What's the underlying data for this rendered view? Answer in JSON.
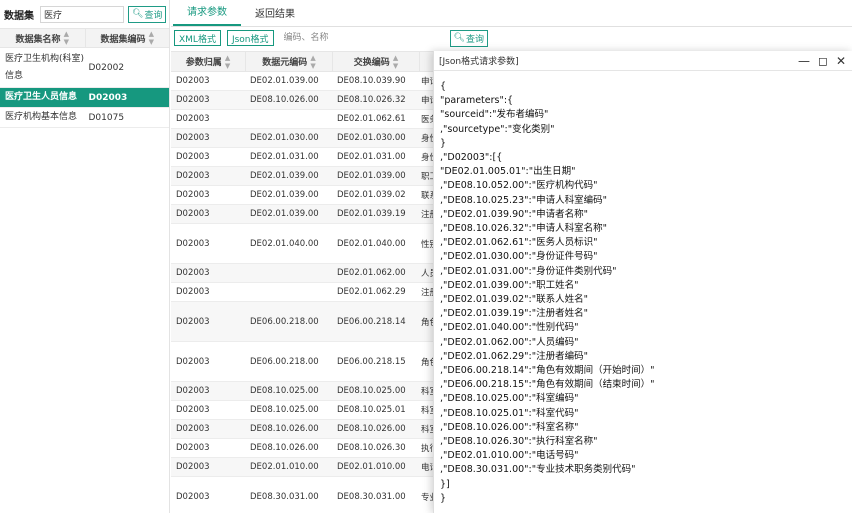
{
  "left_panel": {
    "title": "数据集",
    "search_value": "医疗",
    "query_label": "查询",
    "columns": [
      "数据集名称",
      "数据集编码"
    ],
    "rows": [
      {
        "name_line1": "医疗卫生机构(科室)",
        "name_line2": "信息",
        "code": "D02002",
        "selected": false
      },
      {
        "name_line1": "医疗卫生人员信息",
        "name_line2": "",
        "code": "D02003",
        "selected": true
      },
      {
        "name_line1": "医疗机构基本信息",
        "name_line2": "",
        "code": "D01075",
        "selected": false
      }
    ]
  },
  "tabs": [
    {
      "label": "请求参数",
      "active": true
    },
    {
      "label": "返回结果",
      "active": false
    }
  ],
  "toolbar": {
    "xml_label": "XML格式",
    "json_label": "Json格式",
    "search_placeholder": "编码、名称",
    "query_label": "查询"
  },
  "grid": {
    "columns": [
      "参数归属",
      "数据元编码",
      "交换编码"
    ],
    "rows": [
      {
        "owner": "D02003",
        "element": "DE02.01.039.00",
        "exchange": "DE08.10.039.90",
        "name": "申请",
        "h": 19
      },
      {
        "owner": "D02003",
        "element": "DE08.10.026.00",
        "exchange": "DE08.10.026.32",
        "name": "申请",
        "h": 19
      },
      {
        "owner": "D02003",
        "element": "",
        "exchange": "DE02.01.062.61",
        "name": "医务",
        "h": 19
      },
      {
        "owner": "D02003",
        "element": "DE02.01.030.00",
        "exchange": "DE02.01.030.00",
        "name": "身份",
        "h": 19
      },
      {
        "owner": "D02003",
        "element": "DE02.01.031.00",
        "exchange": "DE02.01.031.00",
        "name": "身份",
        "h": 19
      },
      {
        "owner": "D02003",
        "element": "DE02.01.039.00",
        "exchange": "DE02.01.039.00",
        "name": "职工",
        "h": 19
      },
      {
        "owner": "D02003",
        "element": "DE02.01.039.00",
        "exchange": "DE02.01.039.02",
        "name": "联系",
        "h": 19
      },
      {
        "owner": "D02003",
        "element": "DE02.01.039.00",
        "exchange": "DE02.01.039.19",
        "name": "注册",
        "h": 19
      },
      {
        "owner": "D02003",
        "element": "DE02.01.040.00",
        "exchange": "DE02.01.040.00",
        "name": "性别",
        "h": 40
      },
      {
        "owner": "D02003",
        "element": "",
        "exchange": "DE02.01.062.00",
        "name": "人员",
        "h": 19
      },
      {
        "owner": "D02003",
        "element": "",
        "exchange": "DE02.01.062.29",
        "name": "注册",
        "h": 19
      },
      {
        "owner": "D02003",
        "element": "DE06.00.218.00",
        "exchange": "DE06.00.218.14",
        "name": "角色",
        "h": 40
      },
      {
        "owner": "D02003",
        "element": "DE06.00.218.00",
        "exchange": "DE06.00.218.15",
        "name": "角色",
        "h": 40
      },
      {
        "owner": "D02003",
        "element": "DE08.10.025.00",
        "exchange": "DE08.10.025.00",
        "name": "科室",
        "h": 19
      },
      {
        "owner": "D02003",
        "element": "DE08.10.025.00",
        "exchange": "DE08.10.025.01",
        "name": "科室",
        "h": 19
      },
      {
        "owner": "D02003",
        "element": "DE08.10.026.00",
        "exchange": "DE08.10.026.00",
        "name": "科室",
        "h": 19
      },
      {
        "owner": "D02003",
        "element": "DE08.10.026.00",
        "exchange": "DE08.10.026.30",
        "name": "执行",
        "h": 19
      },
      {
        "owner": "D02003",
        "element": "DE02.01.010.00",
        "exchange": "DE02.01.010.00",
        "name": "电话",
        "h": 19
      },
      {
        "owner": "D02003",
        "element": "DE08.30.031.00",
        "exchange": "DE08.30.031.00",
        "name": "专业",
        "h": 40
      }
    ]
  },
  "dialog": {
    "title": "[Json格式请求参数]",
    "content": "{\n\"parameters\":{\n\"sourceid\":\"发布者编码\"\n,\"sourcetype\":\"变化类别\"\n}\n,\"D02003\":[{\n\"DE02.01.005.01\":\"出生日期\"\n,\"DE08.10.052.00\":\"医疗机构代码\"\n,\"DE08.10.025.23\":\"申请人科室编码\"\n,\"DE02.01.039.90\":\"申请者名称\"\n,\"DE08.10.026.32\":\"申请人科室名称\"\n,\"DE02.01.062.61\":\"医务人员标识\"\n,\"DE02.01.030.00\":\"身份证件号码\"\n,\"DE02.01.031.00\":\"身份证件类别代码\"\n,\"DE02.01.039.00\":\"职工姓名\"\n,\"DE02.01.039.02\":\"联系人姓名\"\n,\"DE02.01.039.19\":\"注册者姓名\"\n,\"DE02.01.040.00\":\"性别代码\"\n,\"DE02.01.062.00\":\"人员编码\"\n,\"DE02.01.062.29\":\"注册者编码\"\n,\"DE06.00.218.14\":\"角色有效期间（开始时间）\"\n,\"DE06.00.218.15\":\"角色有效期间（结束时间）\"\n,\"DE08.10.025.00\":\"科室编码\"\n,\"DE08.10.025.01\":\"科室代码\"\n,\"DE08.10.026.00\":\"科室名称\"\n,\"DE08.10.026.30\":\"执行科室名称\"\n,\"DE02.01.010.00\":\"电话号码\"\n,\"DE08.30.031.00\":\"专业技术职务类别代码\"\n}]\n}"
  }
}
